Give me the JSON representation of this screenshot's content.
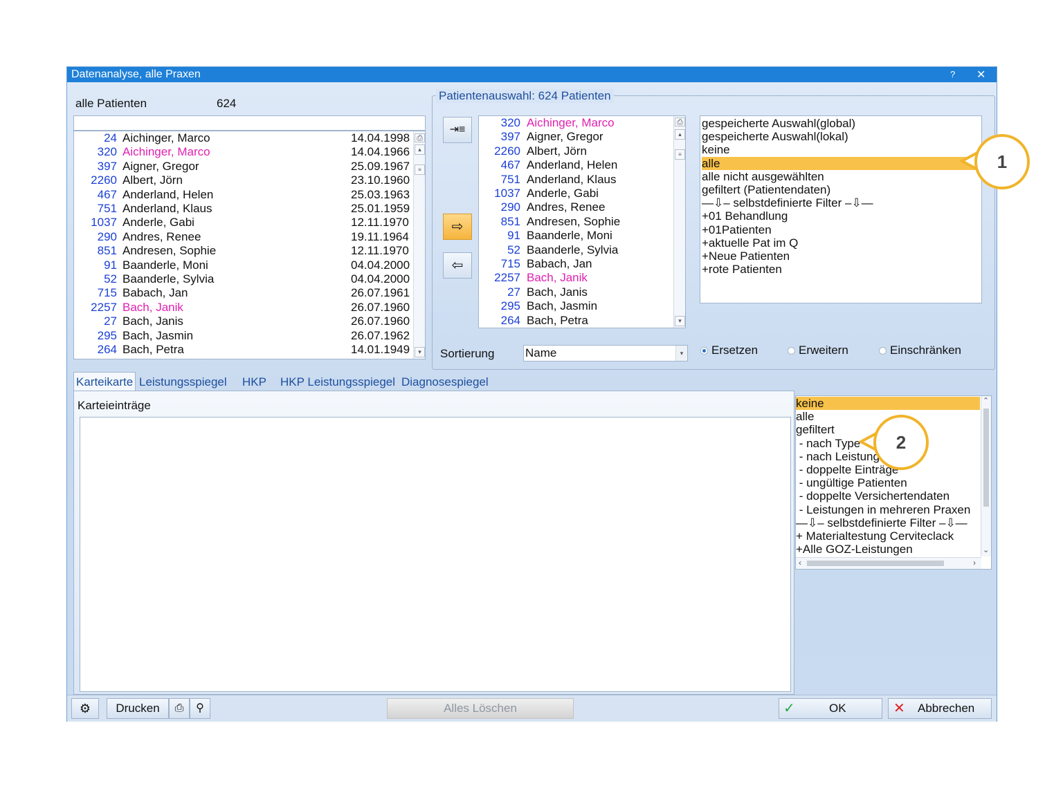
{
  "window": {
    "title": "Datenanalyse, alle Praxen",
    "help": "?",
    "close": "✕"
  },
  "left_list": {
    "label": "alle Patienten",
    "count": "624",
    "rows": [
      {
        "num": "24",
        "name": "Aichinger, Marco",
        "date": "14.04.1998",
        "pink": false
      },
      {
        "num": "320",
        "name": "Aichinger, Marco",
        "date": "14.04.1966",
        "pink": true
      },
      {
        "num": "397",
        "name": "Aigner, Gregor",
        "date": "25.09.1967",
        "pink": false
      },
      {
        "num": "2260",
        "name": "Albert, Jörn",
        "date": "23.10.1960",
        "pink": false
      },
      {
        "num": "467",
        "name": "Anderland, Helen",
        "date": "25.03.1963",
        "pink": false
      },
      {
        "num": "751",
        "name": "Anderland, Klaus",
        "date": "25.01.1959",
        "pink": false
      },
      {
        "num": "1037",
        "name": "Anderle, Gabi",
        "date": "12.11.1970",
        "pink": false
      },
      {
        "num": "290",
        "name": "Andres, Renee",
        "date": "19.11.1964",
        "pink": false
      },
      {
        "num": "851",
        "name": "Andresen, Sophie",
        "date": "12.11.1970",
        "pink": false
      },
      {
        "num": "91",
        "name": "Baanderle, Moni",
        "date": "04.04.2000",
        "pink": false
      },
      {
        "num": "52",
        "name": "Baanderle, Sylvia",
        "date": "04.04.2000",
        "pink": false
      },
      {
        "num": "715",
        "name": "Babach, Jan",
        "date": "26.07.1961",
        "pink": false
      },
      {
        "num": "2257",
        "name": "Bach, Janik",
        "date": "26.07.1960",
        "pink": true
      },
      {
        "num": "27",
        "name": "Bach, Janis",
        "date": "26.07.1960",
        "pink": false
      },
      {
        "num": "295",
        "name": "Bach, Jasmin",
        "date": "26.07.1962",
        "pink": false
      },
      {
        "num": "264",
        "name": "Bach, Petra",
        "date": "14.01.1949",
        "pink": false
      }
    ]
  },
  "selection": {
    "group_title": "Patientenauswahl:   624 Patienten",
    "rows": [
      {
        "num": "320",
        "name": "Aichinger, Marco",
        "pink": true
      },
      {
        "num": "397",
        "name": "Aigner, Gregor",
        "pink": false
      },
      {
        "num": "2260",
        "name": "Albert, Jörn",
        "pink": false
      },
      {
        "num": "467",
        "name": "Anderland, Helen",
        "pink": false
      },
      {
        "num": "751",
        "name": "Anderland, Klaus",
        "pink": false
      },
      {
        "num": "1037",
        "name": "Anderle, Gabi",
        "pink": false
      },
      {
        "num": "290",
        "name": "Andres, Renee",
        "pink": false
      },
      {
        "num": "851",
        "name": "Andresen, Sophie",
        "pink": false
      },
      {
        "num": "91",
        "name": "Baanderle, Moni",
        "pink": false
      },
      {
        "num": "52",
        "name": "Baanderle, Sylvia",
        "pink": false
      },
      {
        "num": "715",
        "name": "Babach, Jan",
        "pink": false
      },
      {
        "num": "2257",
        "name": "Bach, Janik",
        "pink": true
      },
      {
        "num": "27",
        "name": "Bach, Janis",
        "pink": false
      },
      {
        "num": "295",
        "name": "Bach, Jasmin",
        "pink": false
      },
      {
        "num": "264",
        "name": "Bach, Petra",
        "pink": false
      }
    ],
    "filters": [
      "gespeicherte Auswahl(global)",
      "gespeicherte Auswahl(lokal)",
      "keine",
      "alle",
      "alle nicht ausgewählten",
      "gefiltert (Patientendaten)",
      "—⇩– selbstdefinierte Filter –⇩—",
      "+01 Behandlung",
      "+01Patienten",
      "+aktuelle Pat im Q",
      "+Neue Patienten",
      "+rote Patienten"
    ],
    "selected_filter": 3,
    "sort_label": "Sortierung",
    "sort_value": "Name",
    "radio_ersetzen": "Ersetzen",
    "radio_erweitern": "Erweitern",
    "radio_einschraenken": "Einschränken"
  },
  "tabs": [
    "Karteikarte",
    "Leistungsspiegel",
    "HKP",
    "HKP Leistungsspiegel",
    "Diagnosespiegel"
  ],
  "kartei": {
    "label": "Karteieinträge",
    "filters": [
      "keine",
      "alle",
      "gefiltert",
      " - nach Type",
      " - nach Leistung",
      " - doppelte Einträge",
      " - ungültige Patienten",
      " - doppelte Versichertendaten",
      " - Leistungen in mehreren Praxen",
      "—⇩– selbstdefinierte Filter –⇩—",
      "+ Materialtestung Cerviteclack",
      "+Alle GOZ-Leistungen"
    ],
    "selected_filter": 0
  },
  "bottom": {
    "print": "Drucken",
    "clear": "Alles Löschen",
    "ok": "OK",
    "cancel": "Abbrechen"
  },
  "callouts": {
    "one": "1",
    "two": "2"
  },
  "colors": {
    "accent": "#f8c24a",
    "title_bar": "#1e80d8",
    "number": "#1a3fd6",
    "pink": "#e020b0",
    "callout_border": "#f1b42a"
  }
}
